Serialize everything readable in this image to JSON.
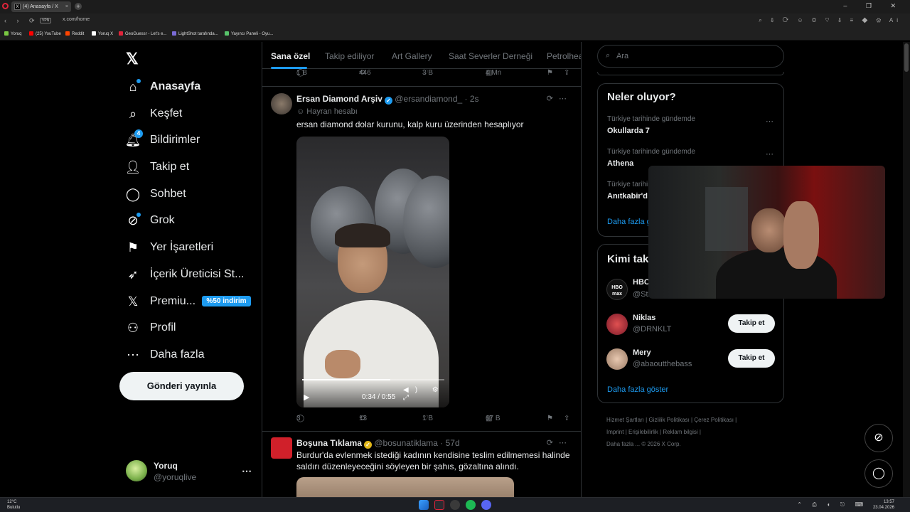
{
  "browser": {
    "tab_title": "(4) Anasayfa / X",
    "tab_close": "×",
    "new_tab": "+",
    "favicon": "X",
    "url": "x.com/home",
    "vpn_label": "VPN",
    "window_controls": "– ❐ ✕",
    "nav_buttons": "‹ › ⟳",
    "toolbar_icons": "⌕ ⇩ ⟳ ☺ ◎ ♡ ⇩ ≡ ◆ ⚙",
    "ai_label": "Ai",
    "bookmarks": [
      {
        "label": "Yoruq",
        "color": "#7ac943"
      },
      {
        "label": "(25) YouTube",
        "color": "#ff0000"
      },
      {
        "label": "Reddit",
        "color": "#ff4500"
      },
      {
        "label": "Yoruq X",
        "color": "#ffffff"
      },
      {
        "label": "GeoGuessr - Let's e...",
        "color": "#e0243a"
      },
      {
        "label": "LightShot tarafında...",
        "color": "#7a6bd6"
      },
      {
        "label": "Yayıncı Paneli - Oyu...",
        "color": "#57c26a"
      }
    ]
  },
  "sidebar": {
    "logo": "𝕏",
    "items": [
      {
        "label": "Anasayfa",
        "icon": "⌂",
        "icon_name": "home-icon"
      },
      {
        "label": "Keşfet",
        "icon": "⌕",
        "icon_name": "search-icon"
      },
      {
        "label": "Bildirimler",
        "icon": "🔔︎",
        "icon_name": "bell-icon",
        "badge": "4"
      },
      {
        "label": "Takip et",
        "icon": "👤︎",
        "icon_name": "follow-icon"
      },
      {
        "label": "Sohbet",
        "icon": "◯",
        "icon_name": "chat-icon"
      },
      {
        "label": "Grok",
        "icon": "⊘",
        "icon_name": "grok-icon"
      },
      {
        "label": "Yer İşaretleri",
        "icon": "⚑",
        "icon_name": "bookmark-icon"
      },
      {
        "label": "İçerik Üreticisi St...",
        "icon": "➶",
        "icon_name": "rocket-icon"
      },
      {
        "label": "Premiu...",
        "icon": "𝕏",
        "icon_name": "premium-icon"
      },
      {
        "label": "Profil",
        "icon": "⚇",
        "icon_name": "profile-icon"
      },
      {
        "label": "Daha fazla",
        "icon": "⋯",
        "icon_name": "more-icon"
      }
    ],
    "premium_badge": "%50 indirim",
    "post_button": "Gönderi yayınla",
    "account": {
      "name": "Yoruq",
      "handle": "@yoruqlive",
      "more": "⋯"
    }
  },
  "feed": {
    "tabs": [
      "Sana özel",
      "Takip ediliyor",
      "Art Gallery",
      "Saat Severler Derneği",
      "Petrolhea"
    ],
    "top_actions": {
      "replies": "1 B",
      "reposts": "446",
      "likes": "3 B",
      "views": "4 Mn"
    },
    "post1": {
      "name": "Ersan Diamond Arşiv",
      "handle": "@ersandiamond_",
      "time": "· 2s",
      "label": "Hayran hesabı",
      "label_icon": "☺",
      "text": "ersan diamond dolar kurunu, kalp kuru üzerinden hesaplıyor",
      "video_time": "0:34 / 0:55",
      "video_progress": 0.62,
      "actions": {
        "replies": "3",
        "reposts": "13",
        "likes": "1 B",
        "views": "67 B"
      }
    },
    "post2": {
      "name": "Boşuna Tıklama",
      "handle": "@bosunatiklama",
      "time": "· 57d",
      "text": "Burdur'da evlenmek istediği kadının kendisine teslim edilmemesi halinde saldırı düzenleyeceğini söyleyen bir şahıs, gözaltına alındı."
    },
    "icons": {
      "reply": "◯",
      "repost": "⟲",
      "like": "♡",
      "views": "▥",
      "bookmark": "⚑",
      "share": "⇪",
      "grok": "⟳",
      "more": "⋯",
      "verified": "✓",
      "play": "▶",
      "video_controls": "◀) ⚙ ⤢"
    }
  },
  "right": {
    "search_placeholder": "Ara",
    "search_icon": "⌕",
    "trends_title": "Neler oluyor?",
    "trends": [
      {
        "sub": "Türkiye tarihinde gündemde",
        "name": "Okullarda 7"
      },
      {
        "sub": "Türkiye tarihinde gündemde",
        "name": "Athena"
      },
      {
        "sub": "Türkiye tarihinde",
        "name": "Anıtkabir'd"
      }
    ],
    "trends_more": "Daha fazla g",
    "who_title": "Kimi tak",
    "who": [
      {
        "name": "HBO",
        "handle": "@Stre",
        "avatar_text": "HBO max"
      },
      {
        "name": "Niklas",
        "handle": "@DRNKLT",
        "button": "Takip et"
      },
      {
        "name": "Mery",
        "handle": "@abaoutthebass",
        "button": "Takip et"
      }
    ],
    "who_more": "Daha fazla göster",
    "footer": [
      "Hizmet Şartları",
      "|",
      "Gizlilik Politikası",
      "|",
      "Çerez Politikası",
      "|",
      "Imprint",
      "|",
      "Erişilebilirlik",
      "|",
      "Reklam bilgisi",
      "|",
      "Daha fazla ...",
      "© 2026 X Corp."
    ]
  },
  "fabs": {
    "grok": "⊘",
    "chat": "◯"
  },
  "taskbar": {
    "temp": "12°C",
    "weather": "Bulutlu",
    "time": "13:57",
    "date": "23.04.2026",
    "tray": "⌃ ⎙ ◖ ⎋ ⌨"
  }
}
